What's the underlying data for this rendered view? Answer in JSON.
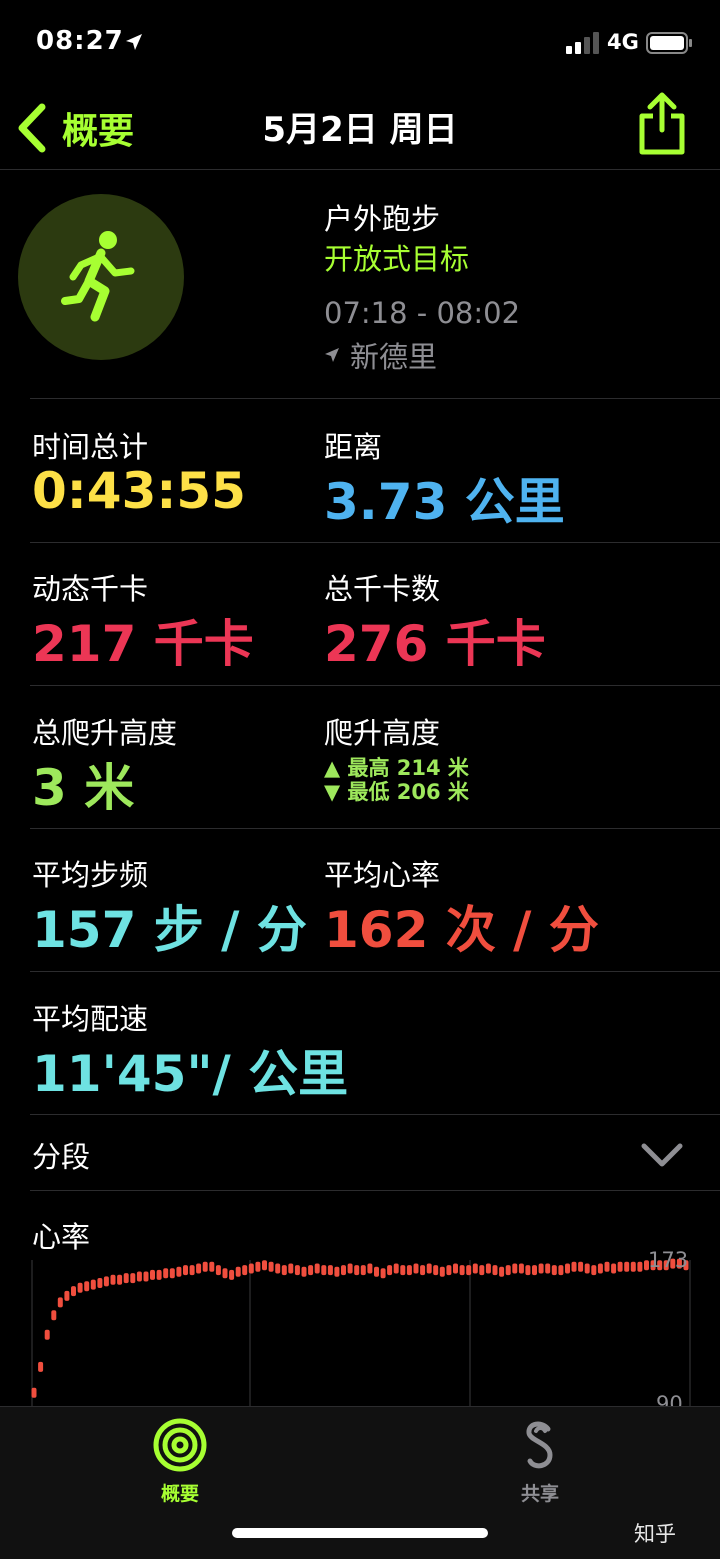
{
  "status_bar": {
    "time": "08:27",
    "network": "4G"
  },
  "nav": {
    "back_label": "概要",
    "title": "5月2日 周日"
  },
  "workout": {
    "name": "户外跑步",
    "goal": "开放式目标",
    "time_range": "07:18 - 08:02",
    "location": "新德里"
  },
  "metrics": {
    "total_time": {
      "label": "时间总计",
      "value": "0:43:55"
    },
    "distance": {
      "label": "距离",
      "value": "3.73 公里"
    },
    "active_kcal": {
      "label": "动态千卡",
      "value": "217 千卡"
    },
    "total_kcal": {
      "label": "总千卡数",
      "value": "276 千卡"
    },
    "total_climb": {
      "label": "总爬升高度",
      "value": "3 米"
    },
    "elevation": {
      "label": "爬升高度",
      "highest": "▲ 最高 214 米",
      "lowest": "▼ 最低 206 米"
    },
    "avg_cadence": {
      "label": "平均步频",
      "value": "157 步 / 分"
    },
    "avg_hr": {
      "label": "平均心率",
      "value": "162 次 / 分"
    },
    "avg_pace": {
      "label": "平均配速",
      "value": "11'45\"/ 公里"
    }
  },
  "splits": {
    "label": "分段"
  },
  "heart_rate": {
    "label": "心率",
    "y_max_label": "173",
    "y_min_label": "90"
  },
  "chart_data": {
    "type": "scatter",
    "title": "心率",
    "ylim": [
      90,
      173
    ],
    "x": [
      0,
      1,
      2,
      3,
      4,
      5,
      6,
      7,
      8,
      9,
      10,
      11,
      12,
      13,
      14,
      15,
      16,
      17,
      18,
      19,
      20,
      21,
      22,
      23,
      24,
      25,
      26,
      27,
      28,
      29,
      30,
      31,
      32,
      33,
      34,
      35,
      36,
      37,
      38,
      39,
      40,
      41,
      42,
      43,
      44,
      45,
      46,
      47,
      48,
      49,
      50,
      51,
      52,
      53,
      54,
      55,
      56,
      57,
      58,
      59,
      60,
      61,
      62,
      63,
      64,
      65,
      66,
      67,
      68,
      69,
      70,
      71,
      72,
      73,
      74,
      75,
      76,
      77,
      78,
      79,
      80,
      81,
      82,
      83,
      84,
      85,
      86,
      87,
      88,
      89,
      90,
      91,
      92,
      93,
      94,
      95,
      96,
      97,
      98,
      99
    ],
    "values": [
      92,
      108,
      128,
      140,
      148,
      152,
      155,
      157,
      158,
      159,
      160,
      161,
      162,
      162,
      163,
      163,
      164,
      164,
      165,
      165,
      166,
      166,
      167,
      168,
      168,
      169,
      170,
      170,
      168,
      166,
      165,
      167,
      168,
      169,
      170,
      171,
      170,
      169,
      168,
      169,
      168,
      167,
      168,
      169,
      168,
      168,
      167,
      168,
      169,
      168,
      168,
      169,
      167,
      166,
      168,
      169,
      168,
      168,
      169,
      168,
      169,
      168,
      167,
      168,
      169,
      168,
      168,
      169,
      168,
      169,
      168,
      167,
      168,
      169,
      169,
      168,
      168,
      169,
      169,
      168,
      168,
      169,
      170,
      170,
      169,
      168,
      169,
      170,
      169,
      170,
      170,
      170,
      170,
      171,
      171,
      171,
      171,
      172,
      172,
      171
    ],
    "grid": false
  }
}
